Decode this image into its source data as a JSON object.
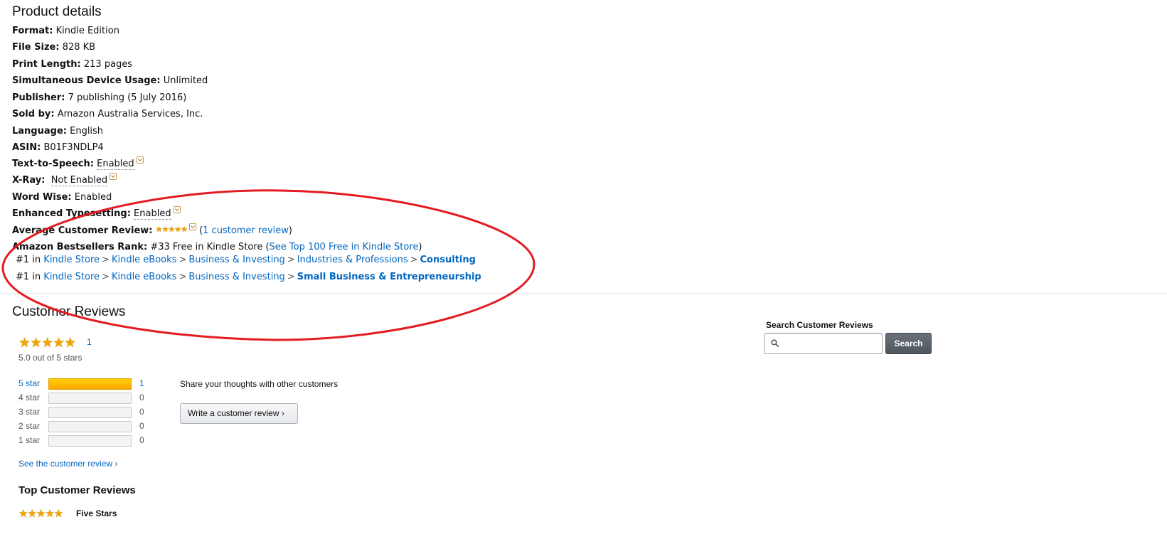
{
  "product_details": {
    "title": "Product details",
    "rows": [
      {
        "label": "Format:",
        "value": "Kindle Edition"
      },
      {
        "label": "File Size:",
        "value": "828 KB"
      },
      {
        "label": "Print Length:",
        "value": "213 pages"
      },
      {
        "label": "Simultaneous Device Usage:",
        "value": "Unlimited"
      },
      {
        "label": "Publisher:",
        "value": "7 publishing (5 July 2016)"
      },
      {
        "label": "Sold by:",
        "value": "Amazon Australia Services, Inc."
      },
      {
        "label": "Language:",
        "value": "English"
      },
      {
        "label": "ASIN:",
        "value": "B01F3NDLP4"
      },
      {
        "label": "Text-to-Speech:",
        "value": "Enabled"
      },
      {
        "label": "X-Ray:",
        "value": "Not Enabled"
      },
      {
        "label": "Word Wise:",
        "value": "Enabled"
      },
      {
        "label": "Enhanced Typesetting:",
        "value": "Enabled"
      }
    ],
    "avg_review": {
      "label": "Average Customer Review:",
      "open": "(",
      "link": "1 customer review",
      "close": ")"
    },
    "bestsellers": {
      "label": "Amazon Bestsellers Rank:",
      "value": "#33 Free in Kindle Store",
      "open": "(",
      "link": "See Top 100 Free in Kindle Store",
      "close": ")",
      "sub1": {
        "rank": "#1 in",
        "path": [
          "Kindle Store",
          "Kindle eBooks",
          "Business & Investing",
          "Industries & Professions"
        ],
        "last": "Consulting"
      },
      "sub2": {
        "rank": "#1 in",
        "path": [
          "Kindle Store",
          "Kindle eBooks",
          "Business & Investing"
        ],
        "last": "Small Business & Entrepreneurship"
      },
      "separator": ">"
    }
  },
  "customer_reviews": {
    "title": "Customer Reviews",
    "stars_glyph": "★★★★★",
    "total_count": "1",
    "summary": "5.0 out of 5 stars",
    "histogram": [
      {
        "label": "5 star",
        "count": "1",
        "fill": 1.0
      },
      {
        "label": "4 star",
        "count": "0",
        "fill": 0
      },
      {
        "label": "3 star",
        "count": "0",
        "fill": 0
      },
      {
        "label": "2 star",
        "count": "0",
        "fill": 0
      },
      {
        "label": "1 star",
        "count": "0",
        "fill": 0
      }
    ],
    "see_review_link": "See the customer review ›",
    "share_text": "Share your thoughts with other customers",
    "write_review_button": "Write a customer review ›",
    "top_reviews_title": "Top Customer Reviews",
    "top_review": {
      "title": "Five Stars"
    }
  },
  "search": {
    "label": "Search Customer Reviews",
    "placeholder": "",
    "button": "Search"
  },
  "annotation": {
    "color": "#e31b23",
    "shape": "ellipse"
  },
  "colors": {
    "link": "#0066c0",
    "star": "#f0a500",
    "annotation": "#e31b23"
  }
}
